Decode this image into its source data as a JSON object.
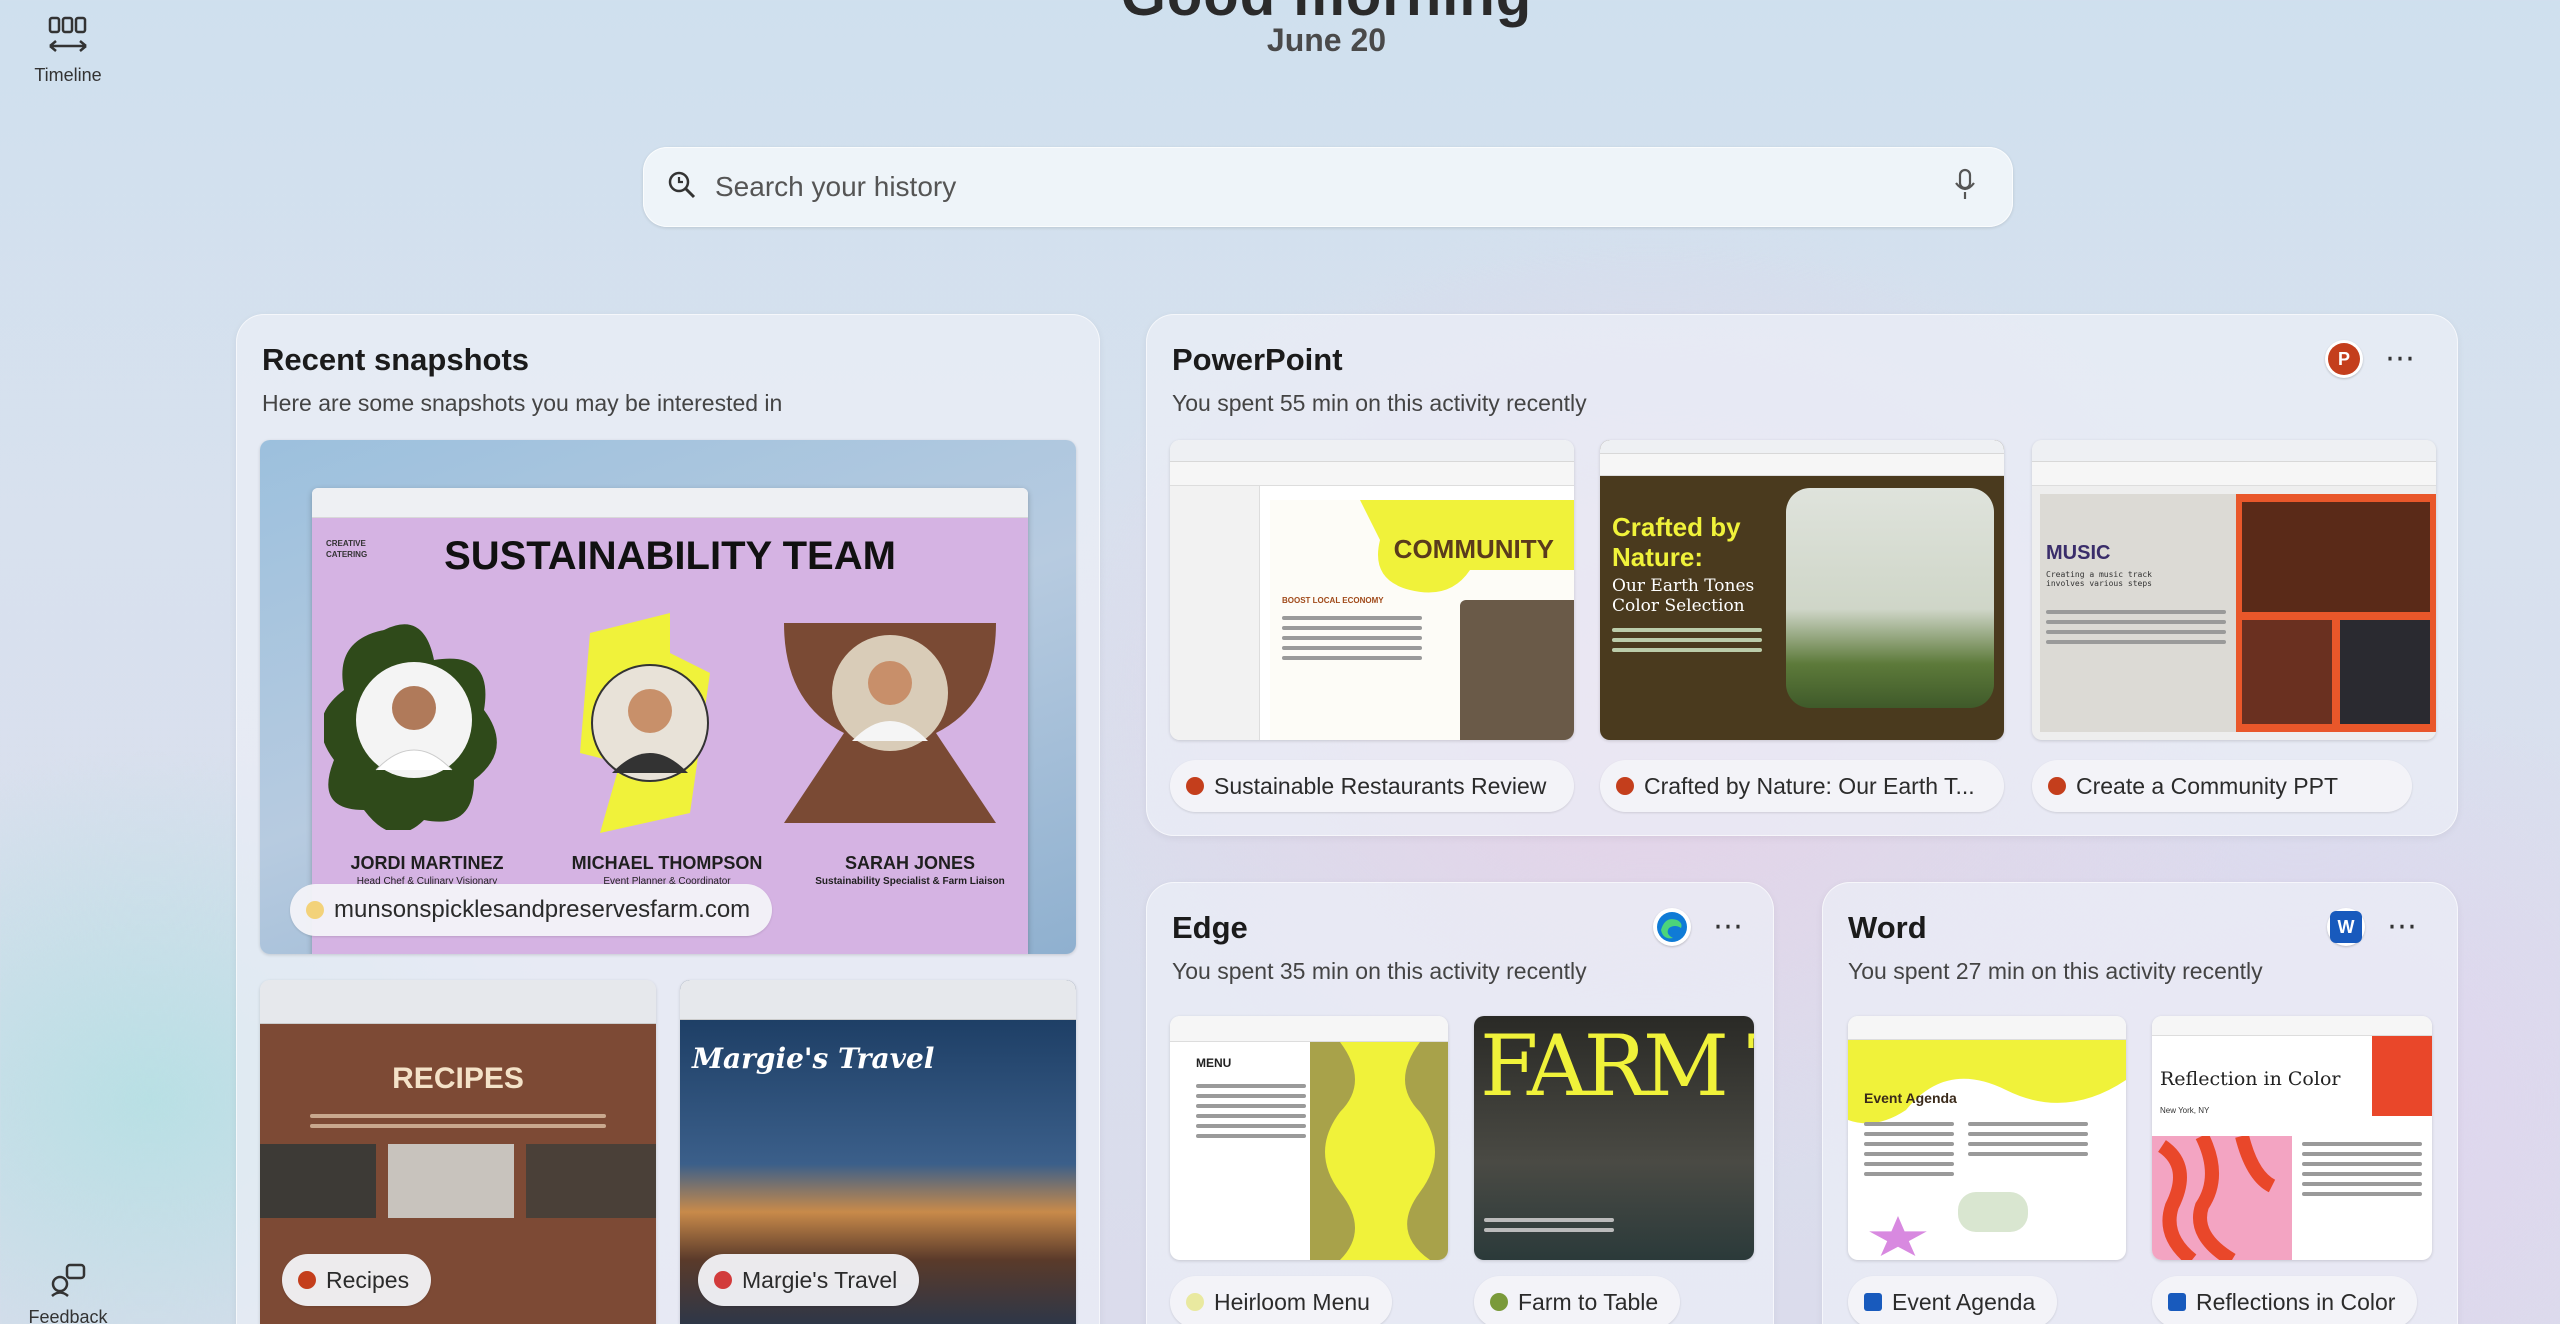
{
  "rail": {
    "timeline_label": "Timeline",
    "feedback_label": "Feedback"
  },
  "header": {
    "greeting": "Good morning",
    "date": "June 20"
  },
  "search": {
    "placeholder": "Search your history"
  },
  "recent": {
    "title": "Recent snapshots",
    "subtitle": "Here are some snapshots you may be interested in",
    "main_snapshot": {
      "site": "munsonspicklesandpreservesfarm.com",
      "slide_title": "SUSTAINABILITY TEAM",
      "slide_brand": "CREATIVE CATERING",
      "people": [
        {
          "name": "JORDI MARTINEZ",
          "role": "Head Chef & Culinary Visionary"
        },
        {
          "name": "MICHAEL THOMPSON",
          "role": "Event Planner & Coordinator"
        },
        {
          "name": "SARAH JONES",
          "role": "Sustainability Specialist & Farm Liaison"
        }
      ]
    },
    "small_snapshots": [
      {
        "label": "Recipes",
        "heading": "RECIPES"
      },
      {
        "label": "Margie's Travel",
        "heading": "Margie's Travel"
      }
    ]
  },
  "powerpoint": {
    "title": "PowerPoint",
    "subtitle": "You spent 55 min on this activity recently",
    "items": [
      {
        "label": "Sustainable Restaurants Review",
        "heading": "COMMUNITY",
        "subheading": "BOOST LOCAL ECONOMY"
      },
      {
        "label": "Crafted by Nature: Our Earth T...",
        "heading": "Crafted by Nature:",
        "subheading": "Our Earth Tones Color Selection"
      },
      {
        "label": "Create a Community PPT",
        "heading": "MUSIC",
        "subheading": "Creating a music track involves various steps"
      }
    ]
  },
  "edge": {
    "title": "Edge",
    "subtitle": "You spent 35 min on this activity recently",
    "items": [
      {
        "label": "Heirloom Menu",
        "heading": "MENU"
      },
      {
        "label": "Farm to Table",
        "heading": "FARM TO"
      }
    ]
  },
  "word": {
    "title": "Word",
    "subtitle": "You spent 27 min on this activity recently",
    "items": [
      {
        "label": "Event Agenda",
        "heading": "Event Agenda"
      },
      {
        "label": "Reflections in Color",
        "heading": "Reflection in Color",
        "subheading": "New York, NY"
      }
    ]
  },
  "colors": {
    "powerpoint": "#c43e1c",
    "word": "#185abd",
    "edge": "#0f7bd6",
    "slide_purple": "#d5b3e3",
    "accent_yellow": "#f0f23a"
  }
}
